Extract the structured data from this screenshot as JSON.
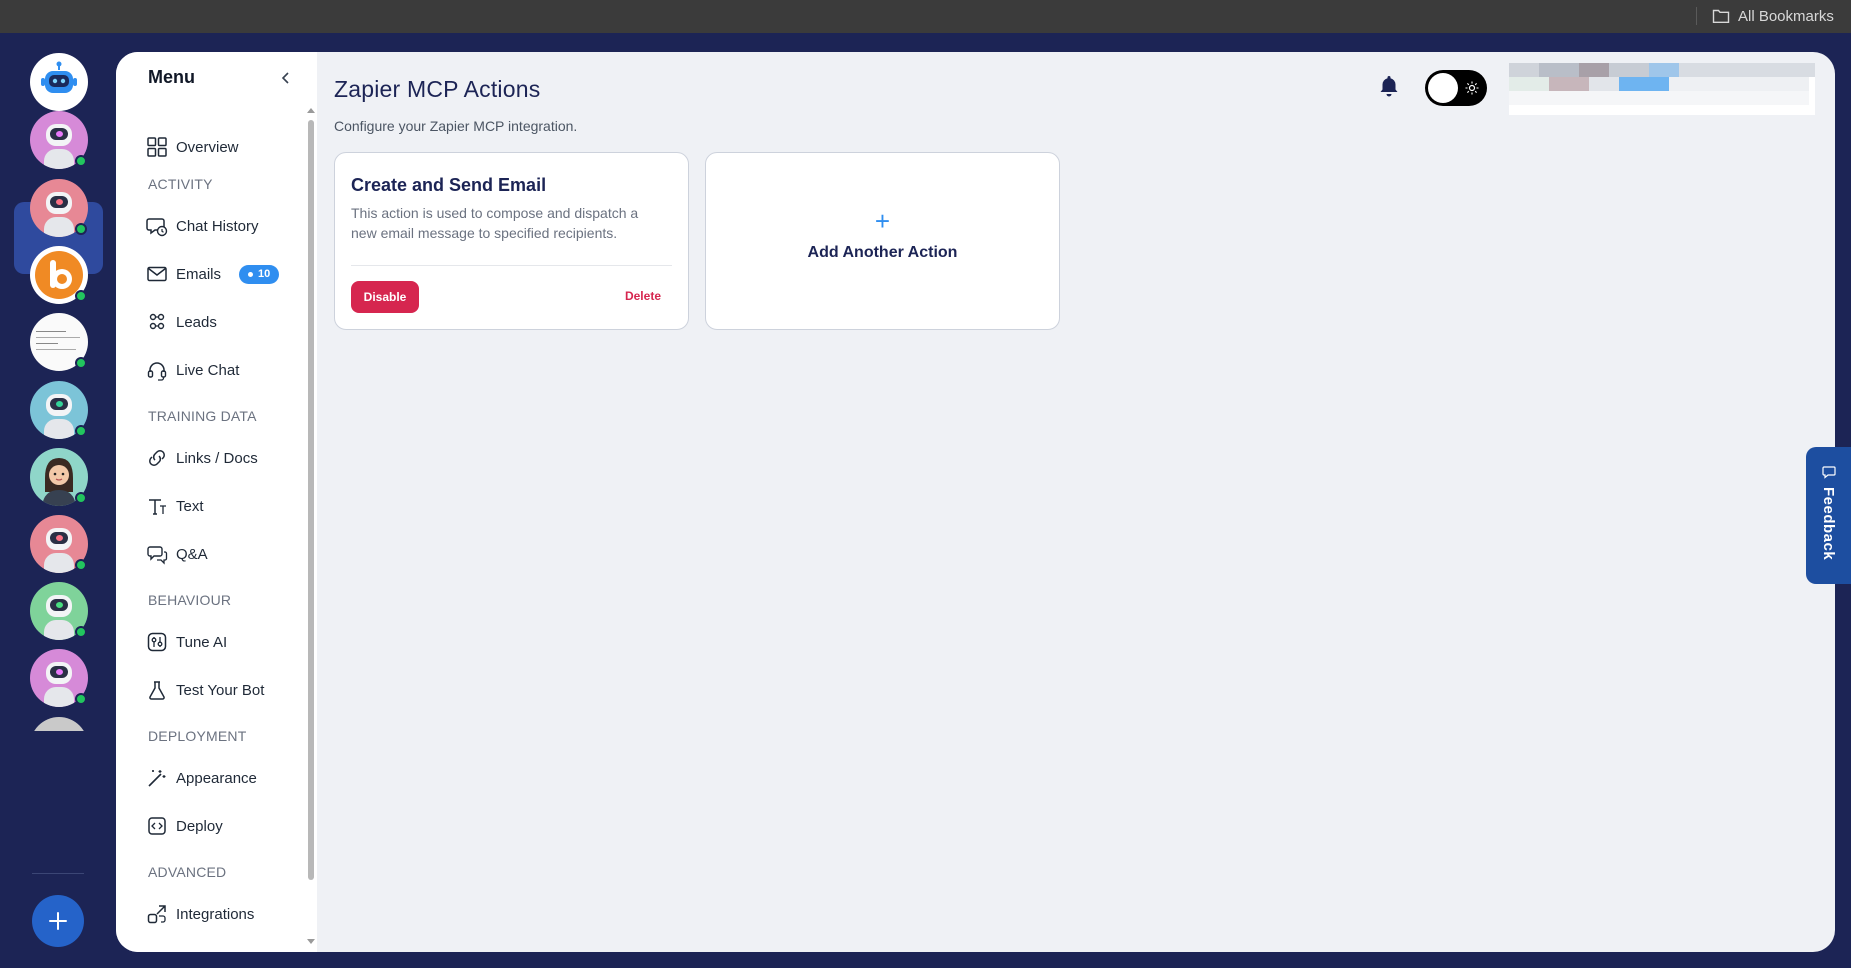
{
  "browser": {
    "bookmarks_label": "All Bookmarks"
  },
  "menu": {
    "title": "Menu",
    "items": [
      {
        "label": "Overview",
        "icon": "grid-icon"
      },
      {
        "label": "ACTIVITY",
        "section": true
      },
      {
        "label": "Chat History",
        "icon": "chat-history-icon"
      },
      {
        "label": "Emails",
        "icon": "mail-icon",
        "badge": "10"
      },
      {
        "label": "Leads",
        "icon": "leads-icon"
      },
      {
        "label": "Live Chat",
        "icon": "headset-icon"
      },
      {
        "label": "TRAINING DATA",
        "section": true
      },
      {
        "label": "Links / Docs",
        "icon": "link-icon"
      },
      {
        "label": "Text",
        "icon": "text-icon"
      },
      {
        "label": "Q&A",
        "icon": "qa-icon"
      },
      {
        "label": "BEHAVIOUR",
        "section": true
      },
      {
        "label": "Tune AI",
        "icon": "tune-icon"
      },
      {
        "label": "Test Your Bot",
        "icon": "flask-icon"
      },
      {
        "label": "DEPLOYMENT",
        "section": true
      },
      {
        "label": "Appearance",
        "icon": "magic-wand-icon"
      },
      {
        "label": "Deploy",
        "icon": "code-icon"
      },
      {
        "label": "ADVANCED",
        "section": true
      },
      {
        "label": "Integrations",
        "icon": "integrations-icon"
      }
    ]
  },
  "page": {
    "title": "Zapier MCP Actions",
    "subtitle": "Configure your Zapier MCP integration."
  },
  "action_card": {
    "title": "Create and Send Email",
    "description": "This action is used to compose and dispatch a new email message to specified recipients.",
    "disable_label": "Disable",
    "delete_label": "Delete"
  },
  "add_card": {
    "plus": "+",
    "label": "Add Another Action"
  },
  "feedback": {
    "label": "Feedback"
  },
  "colors": {
    "rail_bg": "#1c2455",
    "accent_blue": "#2f8ef0",
    "danger": "#d6264f",
    "online": "#22c55e"
  }
}
